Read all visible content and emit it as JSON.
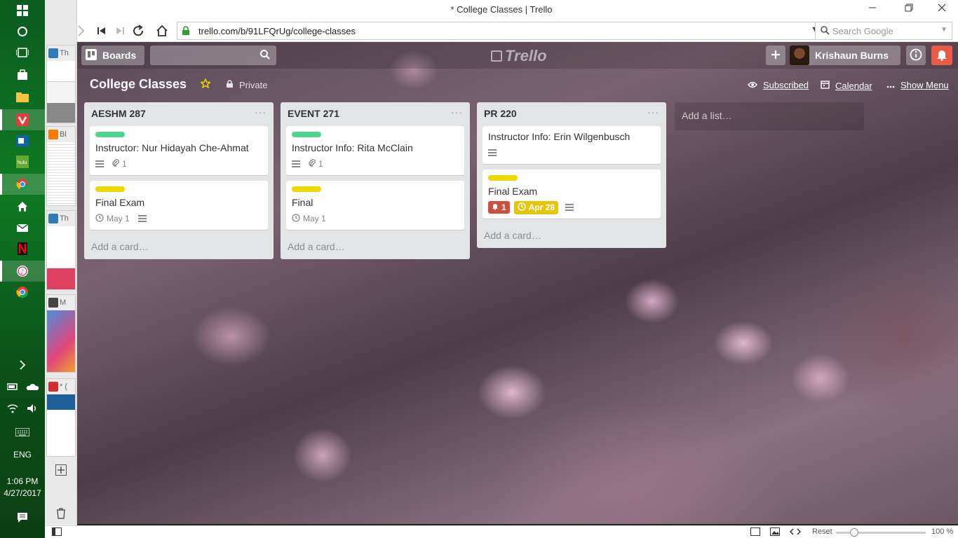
{
  "window": {
    "title": "* College Classes | Trello"
  },
  "browser": {
    "url": "trello.com/b/91LFQrUg/college-classes",
    "search_placeholder": "Search Google"
  },
  "taskbar": {
    "lang": "ENG",
    "time": "1:06 PM",
    "date": "4/27/2017"
  },
  "sidepanel": {
    "tabs": [
      {
        "label": "Th",
        "fav": "#2f7ab9"
      },
      {
        "label": "Bl",
        "fav": "#f57d00"
      },
      {
        "label": "Th",
        "fav": "#2f7ab9"
      },
      {
        "label": "M",
        "fav": "#444444"
      },
      {
        "label": "* (",
        "fav": "#d32f2f"
      }
    ]
  },
  "trello": {
    "header": {
      "boards_label": "Boards",
      "logo_text": "Trello",
      "user_name": "Krishaun Burns"
    },
    "board": {
      "title": "College Classes",
      "privacy": "Private",
      "subscribed": "Subscribed",
      "calendar": "Calendar",
      "show_menu": "Show Menu"
    },
    "lists": [
      {
        "title": "AESHM 287",
        "menu": "···",
        "cards": [
          {
            "label": "green",
            "title": "Instructor: Nur Hidayah Che-Ahmat",
            "attachments": "1"
          },
          {
            "label": "yellow",
            "title": "Final Exam",
            "due": "May 1"
          }
        ],
        "add_card": "Add a card…"
      },
      {
        "title": "EVENT 271",
        "menu": "···",
        "cards": [
          {
            "label": "green",
            "title": "Instructor Info: Rita McClain",
            "attachments": "1"
          },
          {
            "label": "yellow",
            "title": "Final",
            "due": "May 1"
          }
        ],
        "add_card": "Add a card…"
      },
      {
        "title": "PR 220",
        "menu": "···",
        "cards": [
          {
            "title": "Instructor Info: Erin Wilgenbusch"
          },
          {
            "label": "yellow",
            "title": "Final Exam",
            "notifications": "1",
            "due": "Apr 28"
          }
        ],
        "add_card": "Add a card…"
      }
    ],
    "add_list": "Add a list…"
  },
  "statusbar": {
    "reset": "Reset",
    "zoom": "100 %"
  },
  "colors": {
    "taskbar": "#0e7a22",
    "list_bg": "#e2e4e6",
    "label_green": "#4fd48f",
    "label_yellow": "#f2d600",
    "notify_red": "#eb5a46"
  }
}
